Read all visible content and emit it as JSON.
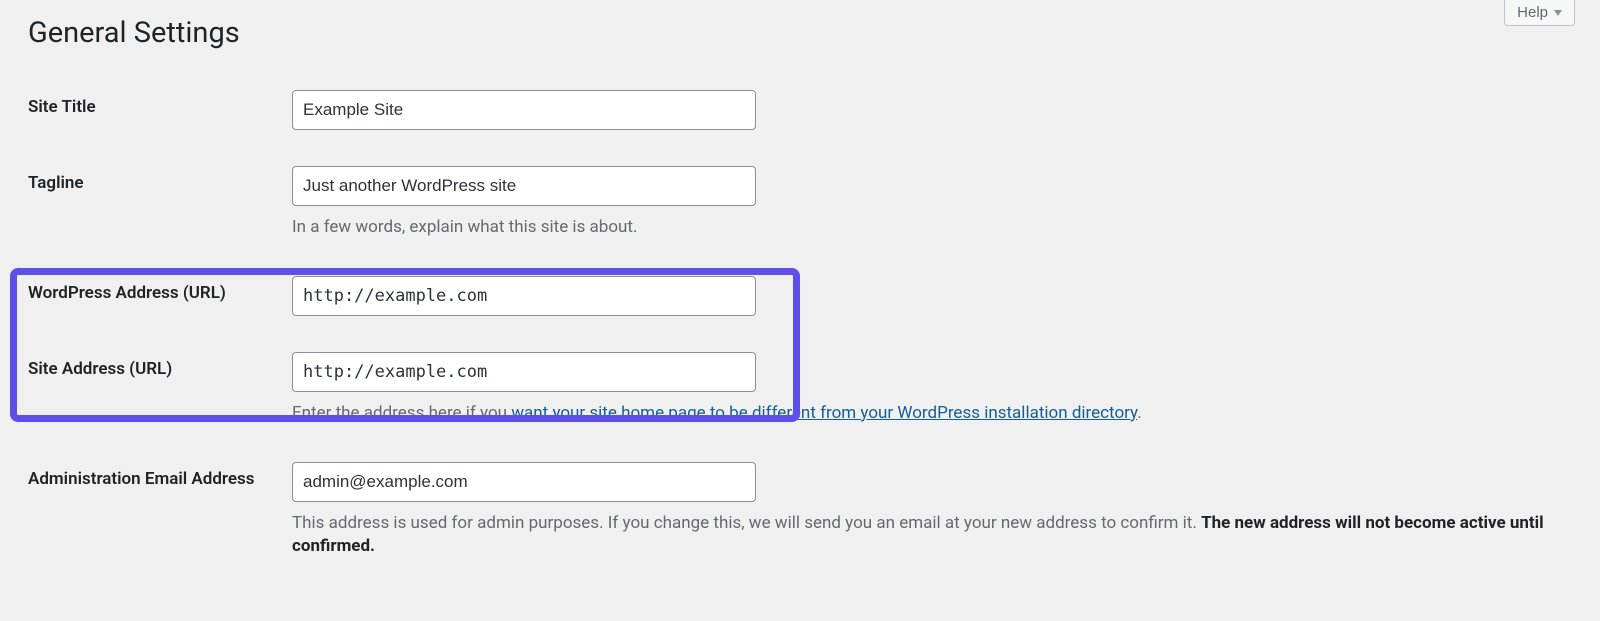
{
  "help": {
    "label": "Help"
  },
  "page": {
    "title": "General Settings"
  },
  "fields": {
    "site_title": {
      "label": "Site Title",
      "value": "Example Site"
    },
    "tagline": {
      "label": "Tagline",
      "value": "Just another WordPress site",
      "description": "In a few words, explain what this site is about."
    },
    "wp_address": {
      "label": "WordPress Address (URL)",
      "value": "http://example.com"
    },
    "site_address": {
      "label": "Site Address (URL)",
      "value": "http://example.com",
      "description_prefix": "Enter the address here if you ",
      "description_link": "want your site home page to be different from your WordPress installation directory",
      "description_suffix": "."
    },
    "admin_email": {
      "label": "Administration Email Address",
      "value": "admin@example.com",
      "description_prefix": "This address is used for admin purposes. If you change this, we will send you an email at your new address to confirm it. ",
      "description_strong": "The new address will not become active until confirmed."
    }
  }
}
